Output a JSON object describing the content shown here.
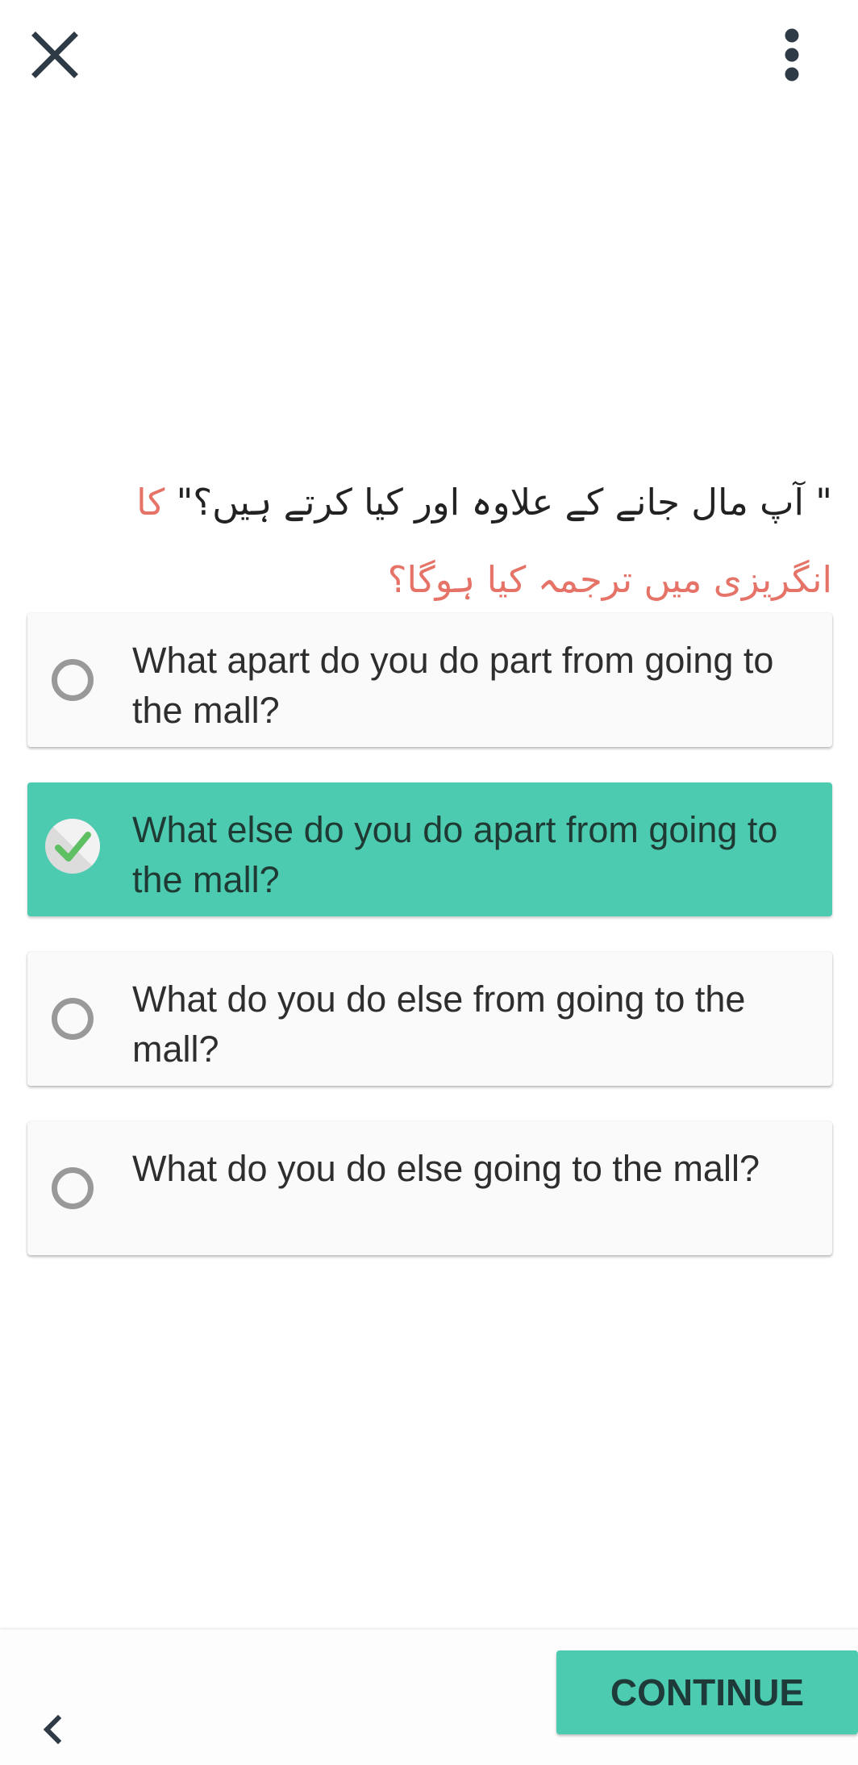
{
  "header": {
    "close_icon": "close-icon",
    "menu_icon": "more-vertical-icon"
  },
  "question": {
    "part_black": "\" آپ مال جانے کے علاوہ اور کیا کرتے ہیں؟\"",
    "part_red": "کا انگریزی میں ترجمہ کیا ہوگا؟"
  },
  "options": [
    {
      "text": "What apart do you do part from going to the mall?",
      "selected": false
    },
    {
      "text": "What else do you do apart from going to the mall?",
      "selected": true
    },
    {
      "text": "What do you do else from going to the mall?",
      "selected": false
    },
    {
      "text": "What do you do else going to the mall?",
      "selected": false
    }
  ],
  "footer": {
    "back_icon": "chevron-left-icon",
    "continue_label": "CONTINUE"
  },
  "colors": {
    "accent": "#4ccbb1",
    "question_red": "#e57368",
    "icon_dark": "#2e3b46",
    "radio_gray": "#999999"
  }
}
